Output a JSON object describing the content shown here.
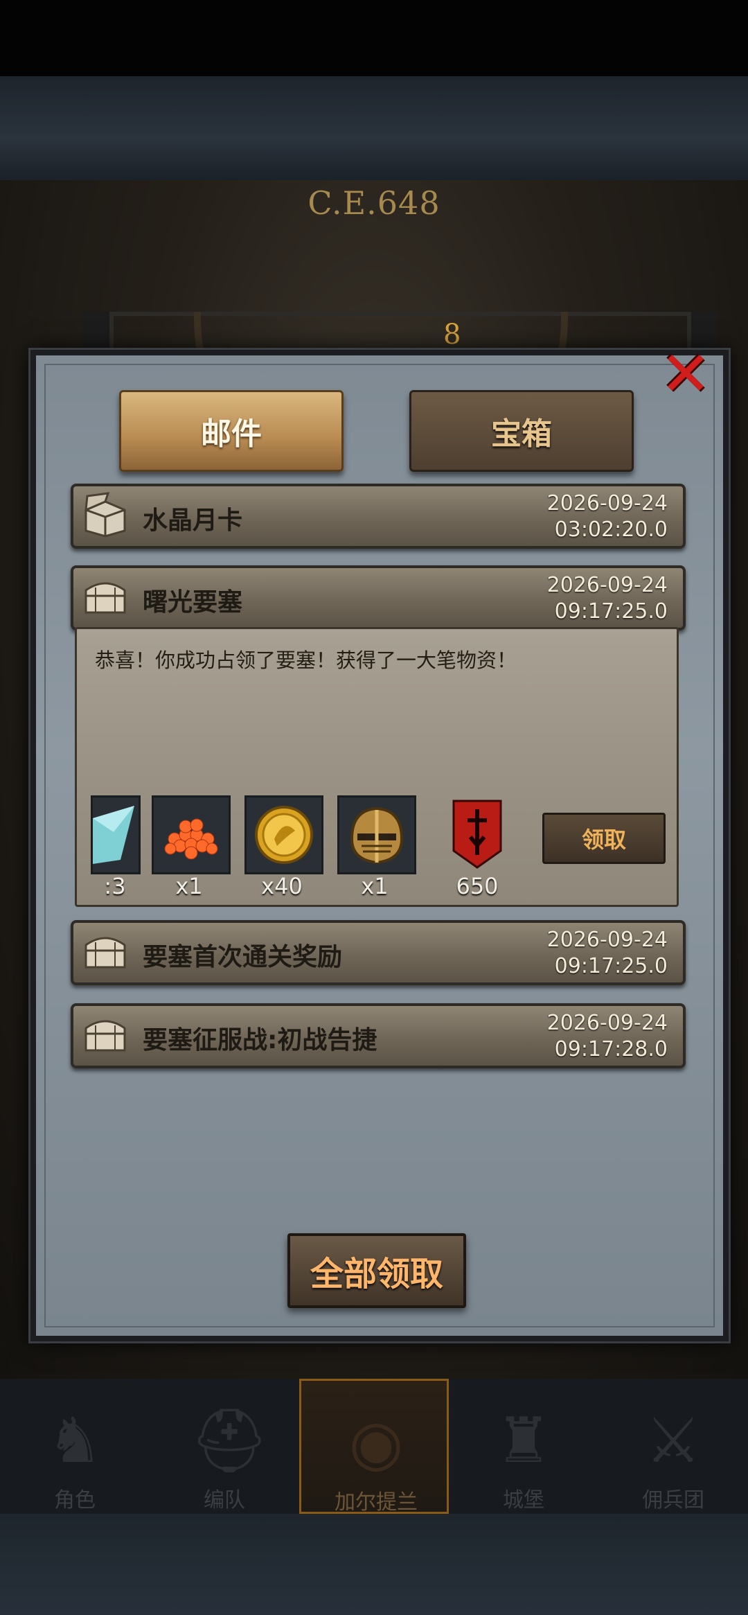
{
  "scene": {
    "era": "C.E.648",
    "dial_current": "8"
  },
  "tabs": [
    {
      "label": "邮件",
      "active": true
    },
    {
      "label": "宝箱",
      "active": false
    }
  ],
  "mails": [
    {
      "title": "水晶月卡",
      "date": "2026-09-24",
      "time": "03:02:20.0"
    },
    {
      "title": "曙光要塞",
      "date": "2026-09-24",
      "time": "09:17:25.0"
    },
    {
      "title": "要塞首次通关奖励",
      "date": "2026-09-24",
      "time": "09:17:25.0"
    },
    {
      "title": "要塞征服战:初战告捷",
      "date": "2026-09-24",
      "time": "09:17:28.0"
    }
  ],
  "expanded": {
    "message": "恭喜！你成功占领了要塞！获得了一大笔物资！",
    "rewards": [
      {
        "icon": "blade-shard-icon",
        "count": ":3"
      },
      {
        "icon": "fish-roe-icon",
        "count": "x1"
      },
      {
        "icon": "gold-coin-icon",
        "count": "x40"
      },
      {
        "icon": "knight-helmet-icon",
        "count": "x1"
      },
      {
        "icon": "red-banner-icon",
        "count": "650"
      }
    ],
    "claim_label": "领取"
  },
  "claim_all_label": "全部领取",
  "nav": [
    {
      "label": "角色",
      "active": false
    },
    {
      "label": "编队",
      "active": false
    },
    {
      "label": "加尔提兰",
      "active": true
    },
    {
      "label": "城堡",
      "active": false
    },
    {
      "label": "佣兵团",
      "active": false
    }
  ],
  "colors": {
    "accent_gold": "#f0b35a",
    "close_red": "#d21d1d"
  }
}
